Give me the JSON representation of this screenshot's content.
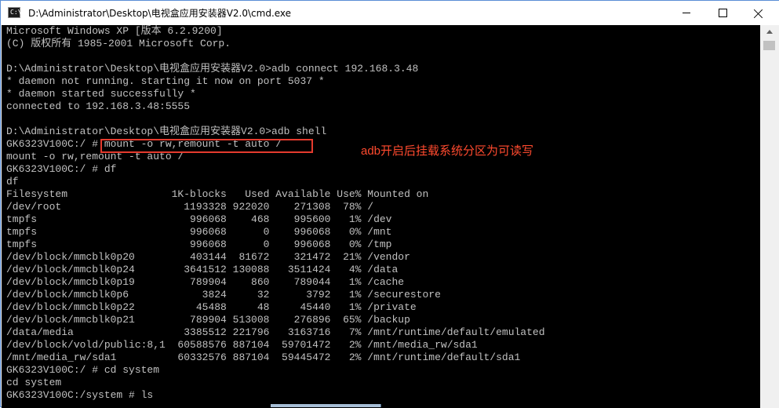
{
  "window": {
    "title": "D:\\Administrator\\Desktop\\电视盒应用安装器V2.0\\cmd.exe",
    "icon_text": "C:\\"
  },
  "console": {
    "lines": [
      "Microsoft Windows XP [版本 6.2.9200]",
      "(C) 版权所有 1985-2001 Microsoft Corp.",
      "",
      "D:\\Administrator\\Desktop\\电视盒应用安装器V2.0>adb connect 192.168.3.48",
      "* daemon not running. starting it now on port 5037 *",
      "* daemon started successfully *",
      "connected to 192.168.3.48:5555",
      "",
      "D:\\Administrator\\Desktop\\电视盒应用安装器V2.0>adb shell",
      "GK6323V100C:/ # mount -o rw,remount -t auto /",
      "mount -o rw,remount -t auto /",
      "GK6323V100C:/ # df",
      "df",
      "Filesystem                 1K-blocks   Used Available Use% Mounted on",
      "/dev/root                    1193328 922020    271308  78% /",
      "tmpfs                         996068    468    995600   1% /dev",
      "tmpfs                         996068      0    996068   0% /mnt",
      "tmpfs                         996068      0    996068   0% /tmp",
      "/dev/block/mmcblk0p20         403144  81672    321472  21% /vendor",
      "/dev/block/mmcblk0p24        3641512 130088   3511424   4% /data",
      "/dev/block/mmcblk0p19         789904    860    789044   1% /cache",
      "/dev/block/mmcblk0p6            3824     32      3792   1% /securestore",
      "/dev/block/mmcblk0p22          45488     48     45440   1% /private",
      "/dev/block/mmcblk0p21         789904 513008    276896  65% /backup",
      "/data/media                  3385512 221796   3163716   7% /mnt/runtime/default/emulated",
      "/dev/block/vold/public:8,1  60588576 887104  59701472   2% /mnt/media_rw/sda1",
      "/mnt/media_rw/sda1          60332576 887104  59445472   2% /mnt/runtime/default/sda1",
      "GK6323V100C:/ # cd system",
      "cd system",
      "GK6323V100C:/system # ls"
    ]
  },
  "annotation": {
    "text": "adb开启后挂载系统分区为可读写",
    "color": "#ff4a2e"
  },
  "colors": {
    "console_bg": "#000000",
    "console_fg": "#c0c0c0",
    "highlight": "#e53b2e"
  }
}
